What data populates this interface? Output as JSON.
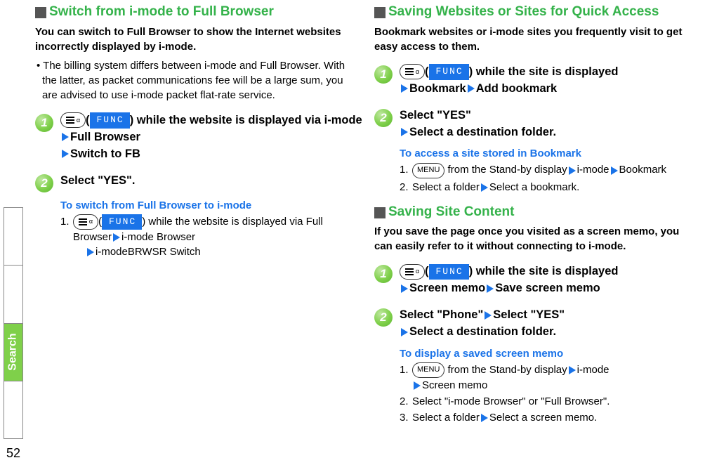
{
  "page_number": "52",
  "side_tab": "Search",
  "left": {
    "title": "Switch from i-mode to Full Browser",
    "intro": "You can switch to Full Browser to show the Internet websites incorrectly displayed by i-mode.",
    "bullet": "The billing system differs between i-mode and Full Browser. With the latter, as packet communications fee will be a large sum, you are advised to use i-mode packet flat-rate service.",
    "step1_a": ") while the website is displayed via i-mode",
    "step1_b": "Full Browser",
    "step1_c": "Switch to FB",
    "step2": "Select \"YES\".",
    "sub_title": "To switch from Full Browser to i-mode",
    "sub1_a": ") while the website is displayed via Full Browser",
    "sub1_b": "i-mode Browser",
    "sub1_c": "i-modeBRWSR Switch",
    "func": "FUNC",
    "menu": "MENU"
  },
  "right": {
    "title1": "Saving Websites or Sites for Quick Access",
    "intro1": "Bookmark websites or i-mode sites you frequently visit to get easy access to them.",
    "r1s1_a": ") while the site is displayed",
    "r1s1_b": "Bookmark",
    "r1s1_c": "Add bookmark",
    "r1s2_a": "Select \"YES\"",
    "r1s2_b": "Select a destination folder.",
    "r1_sub_title": "To access a site stored in Bookmark",
    "r1_sub1_a": " from the Stand-by display",
    "r1_sub1_b": "i-mode",
    "r1_sub1_c": "Bookmark",
    "r1_sub2_a": "Select a folder",
    "r1_sub2_b": "Select a bookmark.",
    "title2": "Saving Site Content",
    "intro2": "If you save the page once you visited as a screen memo, you can easily refer to it without connecting to i-mode.",
    "r2s1_a": ") while the site is displayed",
    "r2s1_b": "Screen memo",
    "r2s1_c": "Save screen memo",
    "r2s2_a": "Select \"Phone\"",
    "r2s2_b": "Select \"YES\"",
    "r2s2_c": "Select a destination folder.",
    "r2_sub_title": "To display a saved screen memo",
    "r2_sub1_a": " from the Stand-by display",
    "r2_sub1_b": "i-mode",
    "r2_sub1_c": "Screen memo",
    "r2_sub2": "Select \"i-mode Browser\" or \"Full Browser\".",
    "r2_sub3_a": "Select a folder",
    "r2_sub3_b": "Select a screen memo.",
    "func": "FUNC",
    "menu": "MENU"
  }
}
